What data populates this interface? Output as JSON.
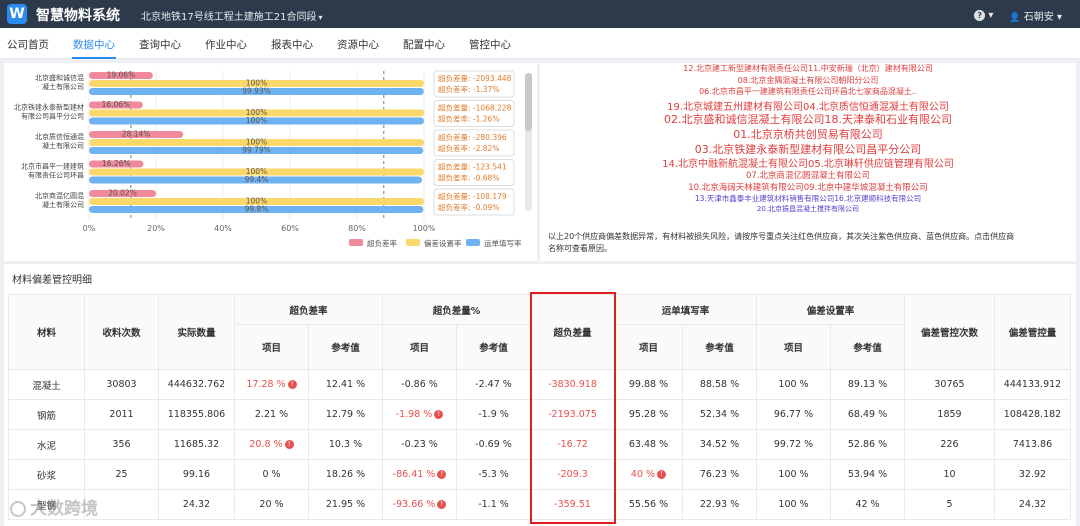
{
  "header": {
    "logo_letter": "W",
    "app_title": "智慧物料系统",
    "project": "北京地铁17号线工程土建施工21合同段",
    "project_caret": "▾",
    "help_icon": "?",
    "help_caret": "▾",
    "user_glyph": "👤",
    "user_name": "石朝安",
    "user_caret": "▾"
  },
  "nav": {
    "items": [
      "公司首页",
      "数据中心",
      "查询中心",
      "作业中心",
      "报表中心",
      "资源中心",
      "配置中心",
      "管控中心"
    ],
    "active_index": 1
  },
  "bar_chart": {
    "x_ticks": [
      "0%",
      "20%",
      "40%",
      "60%",
      "80%",
      "100%"
    ],
    "legend": [
      "超负差率",
      "偏差设置率",
      "运单填写率"
    ],
    "colors": {
      "over": "#f08a9b",
      "deviation": "#fbd86a",
      "waybill": "#6fb2f1"
    },
    "rows": [
      {
        "material": "北京盛和诚信混凝土有限公司",
        "over_pct": 19.06,
        "over_label": "19.06%",
        "dev_label": "100%",
        "bill_pct": 99.93,
        "bill_label": "99.93%",
        "tip_amount": "超负差量: -2093.448",
        "tip_rate": "超负差率: -1.37%"
      },
      {
        "material": "北京铁建永泰新型建材有限公司昌平分公司",
        "over_pct": 16.06,
        "over_label": "16.06%",
        "dev_label": "100%",
        "bill_pct": 100,
        "bill_label": "100%",
        "tip_amount": "超负差量: -1068.228",
        "tip_rate": "超负差率: -1.26%"
      },
      {
        "material": "北京质信恒通混凝土有限公司",
        "over_pct": 28.14,
        "over_label": "28.14%",
        "dev_label": "100%",
        "bill_pct": 99.79,
        "bill_label": "99.79%",
        "tip_amount": "超负差量: -280.396",
        "tip_rate": "超负差率: -2.82%"
      },
      {
        "material": "北京市昌平一建建筑有限责任公司环昌",
        "over_pct": 16.26,
        "over_label": "16.26%",
        "dev_label": "100%",
        "bill_pct": 99.4,
        "bill_label": "99.4%",
        "tip_amount": "超负差量: -123.541",
        "tip_rate": "超负差率: -0.68%"
      },
      {
        "material": "北京商混亿圆混凝土有限公司",
        "over_pct": 20.02,
        "over_label": "20.02%",
        "dev_label": "100%",
        "bill_pct": 99.8,
        "bill_label": "99.8%",
        "tip_amount": "超负差量: -108.179",
        "tip_rate": "超负差率: -0.09%"
      }
    ]
  },
  "suppliers": [
    {
      "text": "12.北京建工新型建材有限责任公司11.中安新瑞（北京）建材有限公司",
      "color": "red",
      "size": 8
    },
    {
      "text": "08.北京金隅混凝土有限公司朝阳分公司",
      "color": "red",
      "size": 8
    },
    {
      "text": "06.北京市昌平一建建筑有限责任公司环昌北七家商品混凝土..",
      "color": "red",
      "size": 8
    },
    {
      "text": "19.北京城建五州建材有限公司04.北京质信恒通混凝土有限公司",
      "color": "red",
      "size": 10
    },
    {
      "text": "02.北京盛和诚信混凝土有限公司18.天津泰和石业有限公司",
      "color": "red",
      "size": 11
    },
    {
      "text": "01.北京京桥共创贸易有限公司",
      "color": "red",
      "size": 11
    },
    {
      "text": "03.北京铁建永泰新型建材有限公司昌平分公司",
      "color": "red",
      "size": 11
    },
    {
      "text": "14.北京中融新航混凝土有限公司05.北京琳轩供应链管理有限公司",
      "color": "red",
      "size": 10
    },
    {
      "text": "07.北京商混亿圆混凝土有限公司",
      "color": "red",
      "size": 8.5
    },
    {
      "text": "10.北京海阔天林建筑有限公司09.北京中建华城混凝土有限公司",
      "color": "red",
      "size": 8.5
    },
    {
      "text": "13.天津市鑫泰丰业建筑材料销售有限公司16.北京建顺科技有限公司",
      "color": "blue",
      "size": 7.5
    },
    {
      "text": "20.北京振昌混凝土搅拌有限公司",
      "color": "blue",
      "size": 7
    }
  ],
  "supplier_note": "以上20个供应商偏差数据异常，有材料被损失风险，请按序号重点关注红色供应商，其次关注紫色供应商、蓝色供应商。点击供应商名称可查看原因。",
  "detail": {
    "title": "材料偏差管控明细",
    "headers": {
      "material": "材料",
      "count": "收料次数",
      "actual": "实际数量",
      "over_rate": "超负差率",
      "over_pct": "超负差量%",
      "over_amount": "超负差量",
      "bill_rate": "运单填写率",
      "dev_rate": "偏差设置率",
      "ctrl_count": "偏差管控次数",
      "ctrl_amount": "偏差管控量",
      "item": "项目",
      "ref": "参考值"
    },
    "rows": [
      {
        "material": "混凝土",
        "count": "30803",
        "actual": "444632.762",
        "over_rate_item": "17.28 %",
        "over_rate_item_alert": true,
        "over_rate_ref": "12.41 %",
        "over_pct_item": "-0.86 %",
        "over_pct_item_alert": false,
        "over_pct_ref": "-2.47 %",
        "over_amount": "-3830.918",
        "bill_item": "99.88 %",
        "bill_item_alert": false,
        "bill_ref": "88.58 %",
        "dev_item": "100 %",
        "dev_ref": "89.13 %",
        "ctrl_count": "30765",
        "ctrl_amount": "444133.912"
      },
      {
        "material": "钢筋",
        "count": "2011",
        "actual": "118355.806",
        "over_rate_item": "2.21 %",
        "over_rate_item_alert": false,
        "over_rate_ref": "12.79 %",
        "over_pct_item": "-1.98 %",
        "over_pct_item_alert": true,
        "over_pct_ref": "-1.9 %",
        "over_amount": "-2193.075",
        "bill_item": "95.28 %",
        "bill_item_alert": false,
        "bill_ref": "52.34 %",
        "dev_item": "96.77 %",
        "dev_ref": "68.49 %",
        "ctrl_count": "1859",
        "ctrl_amount": "108428.182"
      },
      {
        "material": "水泥",
        "count": "356",
        "actual": "11685.32",
        "over_rate_item": "20.8 %",
        "over_rate_item_alert": true,
        "over_rate_ref": "10.3 %",
        "over_pct_item": "-0.23 %",
        "over_pct_item_alert": false,
        "over_pct_ref": "-0.69 %",
        "over_amount": "-16.72",
        "bill_item": "63.48 %",
        "bill_item_alert": false,
        "bill_ref": "34.52 %",
        "dev_item": "99.72 %",
        "dev_ref": "52.86 %",
        "ctrl_count": "226",
        "ctrl_amount": "7413.86"
      },
      {
        "material": "砂浆",
        "count": "25",
        "actual": "99.16",
        "over_rate_item": "0 %",
        "over_rate_item_alert": false,
        "over_rate_ref": "18.26 %",
        "over_pct_item": "-86.41 %",
        "over_pct_item_alert": true,
        "over_pct_ref": "-5.3 %",
        "over_amount": "-209.3",
        "bill_item": "40 %",
        "bill_item_alert": true,
        "bill_ref": "76.23 %",
        "dev_item": "100 %",
        "dev_ref": "53.94 %",
        "ctrl_count": "10",
        "ctrl_amount": "32.92"
      },
      {
        "material": "型钢",
        "count": "",
        "actual": "24.32",
        "over_rate_item": "20 %",
        "over_rate_item_alert": false,
        "over_rate_ref": "21.95 %",
        "over_pct_item": "-93.66 %",
        "over_pct_item_alert": true,
        "over_pct_ref": "-1.1 %",
        "over_amount": "-359.51",
        "bill_item": "55.56 %",
        "bill_item_alert": false,
        "bill_ref": "22.93 %",
        "dev_item": "100 %",
        "dev_ref": "42 %",
        "ctrl_count": "5",
        "ctrl_amount": "24.32"
      }
    ]
  },
  "watermark": "大数跨境"
}
